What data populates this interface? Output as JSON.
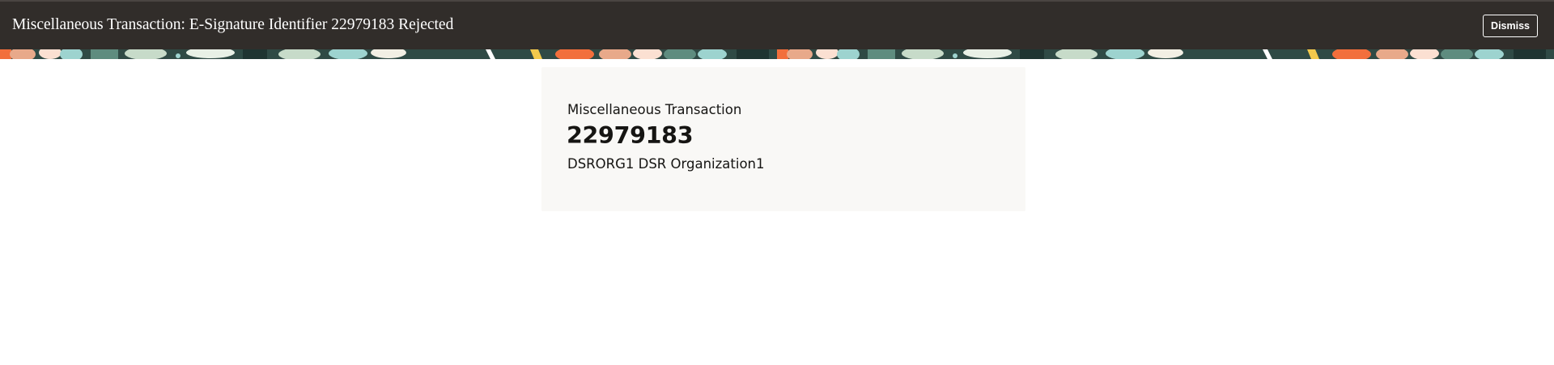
{
  "header": {
    "title": "Miscellaneous Transaction: E-Signature Identifier 22979183 Rejected",
    "dismiss_label": "Dismiss"
  },
  "card": {
    "transaction_type": "Miscellaneous Transaction",
    "identifier": "22979183",
    "organization": "DSRORG1 DSR Organization1"
  },
  "colors": {
    "header_bg": "#312d2a",
    "header_text": "#ffffff",
    "banner_base": "#2f4a45",
    "banner_accents": [
      "#f26f3c",
      "#9dd3cf",
      "#e8a98a",
      "#f2c94c",
      "#c7dbc9",
      "#5e8c7f"
    ],
    "card_bg": "#f9f8f6",
    "text": "#161513"
  }
}
